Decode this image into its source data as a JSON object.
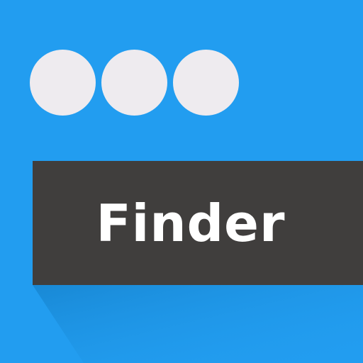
{
  "app_icon": {
    "label": "Finder",
    "dots": [
      "dot-1",
      "dot-2",
      "dot-3"
    ],
    "colors": {
      "background": "#229df0",
      "shadow": "#1a8ad8",
      "dots": "#eeebef",
      "label_bar": "#403e3d",
      "label_text": "#ffffff"
    }
  }
}
